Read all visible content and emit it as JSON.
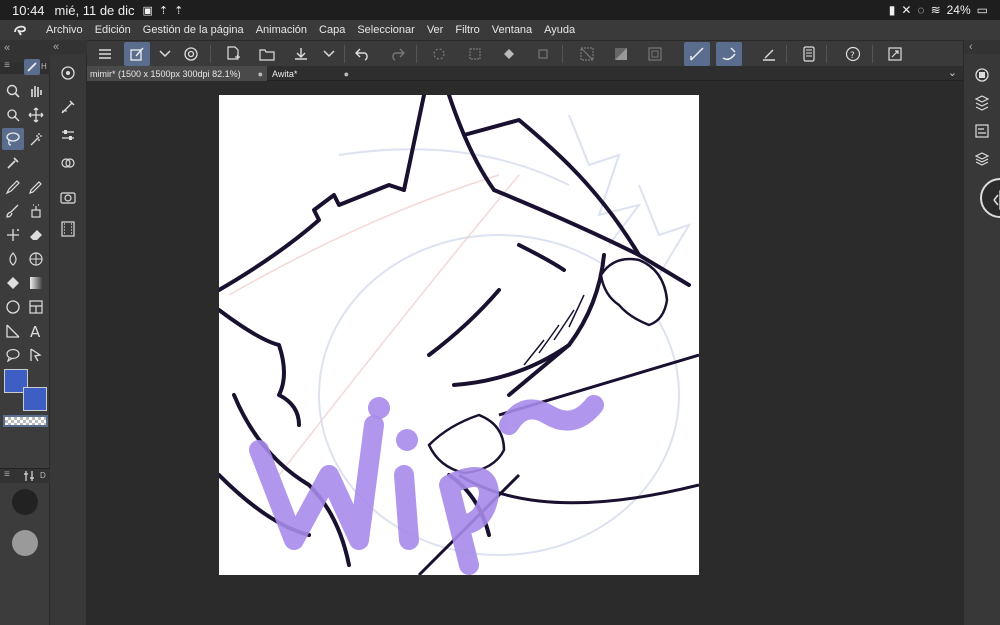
{
  "status_bar": {
    "time": "10:44",
    "date": "mié, 11 de dic",
    "battery": "24%"
  },
  "menu": {
    "items": [
      "Archivo",
      "Edición",
      "Gestión de la página",
      "Animación",
      "Capa",
      "Seleccionar",
      "Ver",
      "Filtro",
      "Ventana",
      "Ayuda"
    ]
  },
  "tabs": [
    {
      "label": "mimir* (1500 x 1500px 300dpi 82.1%)",
      "active": true
    },
    {
      "label": "Awita*",
      "active": false
    }
  ],
  "colors": {
    "main_color": "#3d5fc4",
    "sub_color": "#3d5fc4",
    "accent_active": "#5b6d8e",
    "lineart": "#1a1030",
    "wip_text": "#a78bea"
  },
  "sub_tool_panel": {
    "brush_size_label": "D"
  },
  "canvas": {
    "watermark_text": "Wip~"
  }
}
